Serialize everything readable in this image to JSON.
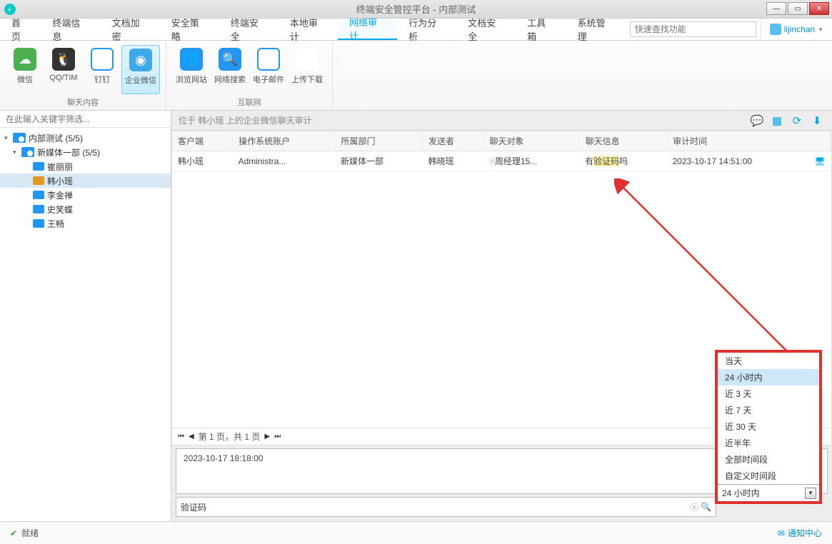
{
  "window": {
    "title": "终端安全管控平台 - 内部测试"
  },
  "menubar": {
    "tabs": [
      "首页",
      "终端信息",
      "文档加密",
      "安全策略",
      "终端安全",
      "本地审计",
      "网络审计",
      "行为分析",
      "文档安全",
      "工具箱",
      "系统管理"
    ],
    "active_index": 6,
    "search_placeholder": "快速查找功能",
    "user": "lijinchan"
  },
  "ribbon": {
    "group1": {
      "label": "聊天内容",
      "items": [
        {
          "label": "微信",
          "icon": "wechat"
        },
        {
          "label": "QQ/TIM",
          "icon": "qq"
        },
        {
          "label": "钉钉",
          "icon": "ding"
        },
        {
          "label": "企业微信",
          "icon": "ent",
          "active": true
        }
      ]
    },
    "group2": {
      "label": "互联网",
      "items": [
        {
          "label": "浏览网站",
          "icon": "web"
        },
        {
          "label": "网络搜索",
          "icon": "search"
        },
        {
          "label": "电子邮件",
          "icon": "mail"
        },
        {
          "label": "上传下载",
          "icon": "upload"
        }
      ]
    }
  },
  "sidebar": {
    "filter_placeholder": "在此输入关键字筛选...",
    "root": {
      "label": "内部测试 (5/5)"
    },
    "dept": {
      "label": "新媒体一部 (5/5)"
    },
    "members": [
      {
        "label": "崔丽丽",
        "online": false
      },
      {
        "label": "韩小瑶",
        "online": true,
        "selected": true
      },
      {
        "label": "李金禅",
        "online": false
      },
      {
        "label": "史笑蝶",
        "online": false
      },
      {
        "label": "王畅",
        "online": false
      }
    ]
  },
  "location": {
    "text": "位于 韩小瑶 上的企业微信聊天审计"
  },
  "table": {
    "headers": [
      "客户端",
      "操作系统账户",
      "所属部门",
      "发送者",
      "聊天对象",
      "聊天信息",
      "审计时间"
    ],
    "row": {
      "client": "韩小瑶",
      "os_account": "Administra...",
      "dept": "新媒体一部",
      "sender": "韩晓瑶",
      "target_blur": "X",
      "target_suffix": "周经理15...",
      "msg_prefix": "有",
      "msg_hl": "验证码",
      "msg_suffix": "吗",
      "time": "2023-10-17 14:51:00"
    }
  },
  "pager": {
    "text": "第 1 页，共 1 页"
  },
  "log": {
    "text": "2023-10-17 18:18:00"
  },
  "filter": {
    "keyword": "验证码",
    "time_combo": "24 小时内",
    "options": [
      "当天",
      "24 小时内",
      "近 3 天",
      "近 7 天",
      "近 30 天",
      "近半年",
      "全部时间段",
      "自定义时间段"
    ],
    "selected_index": 1
  },
  "status": {
    "ready": "就绪",
    "notif": "通知中心"
  }
}
